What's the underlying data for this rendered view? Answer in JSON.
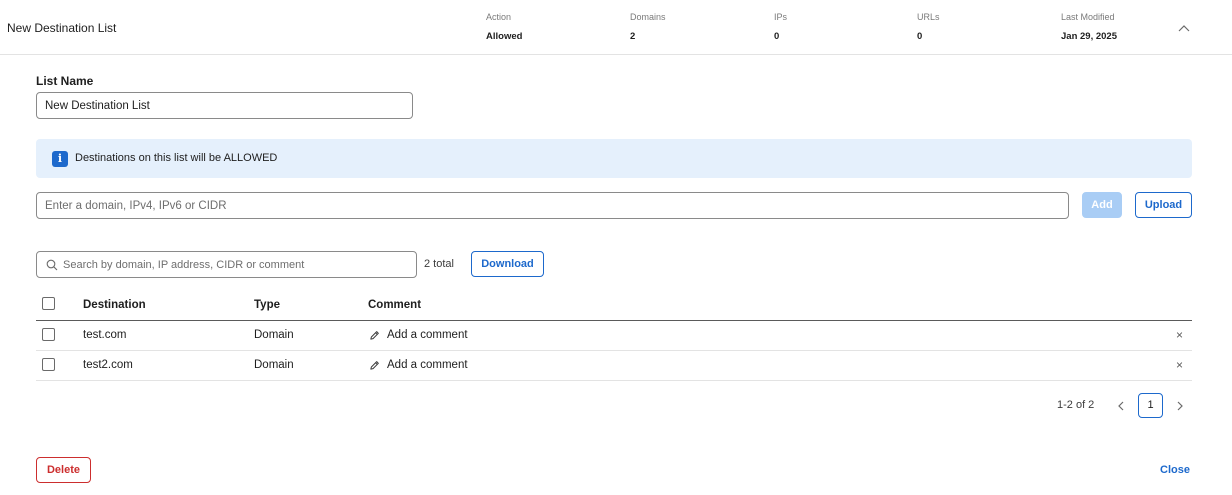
{
  "header": {
    "title": "New Destination List",
    "stats": [
      {
        "label": "Action",
        "value": "Allowed"
      },
      {
        "label": "Domains",
        "value": "2"
      },
      {
        "label": "IPs",
        "value": "0"
      },
      {
        "label": "URLs",
        "value": "0"
      },
      {
        "label": "Last Modified",
        "value": "Jan 29, 2025"
      }
    ]
  },
  "form": {
    "list_name_label": "List Name",
    "list_name_value": "New Destination List",
    "banner_text": "Destinations on this list will be ALLOWED",
    "destination_placeholder": "Enter a domain, IPv4, IPv6 or CIDR",
    "add_label": "Add",
    "upload_label": "Upload"
  },
  "list": {
    "search_placeholder": "Search by domain, IP address, CIDR or comment",
    "total": "2 total",
    "download_label": "Download",
    "columns": [
      "Destination",
      "Type",
      "Comment"
    ],
    "rows": [
      {
        "destination": "test.com",
        "type": "Domain",
        "comment": "Add a comment"
      },
      {
        "destination": "test2.com",
        "type": "Domain",
        "comment": "Add a comment"
      }
    ]
  },
  "pagination": {
    "range": "1-2 of 2",
    "current_page": "1"
  },
  "footer": {
    "delete_label": "Delete",
    "close_label": "Close"
  },
  "colors": {
    "accent": "#1d69cc",
    "danger": "#cc2e2e",
    "banner_bg": "#e5f0fc",
    "disabled": "#a9cdf5"
  }
}
